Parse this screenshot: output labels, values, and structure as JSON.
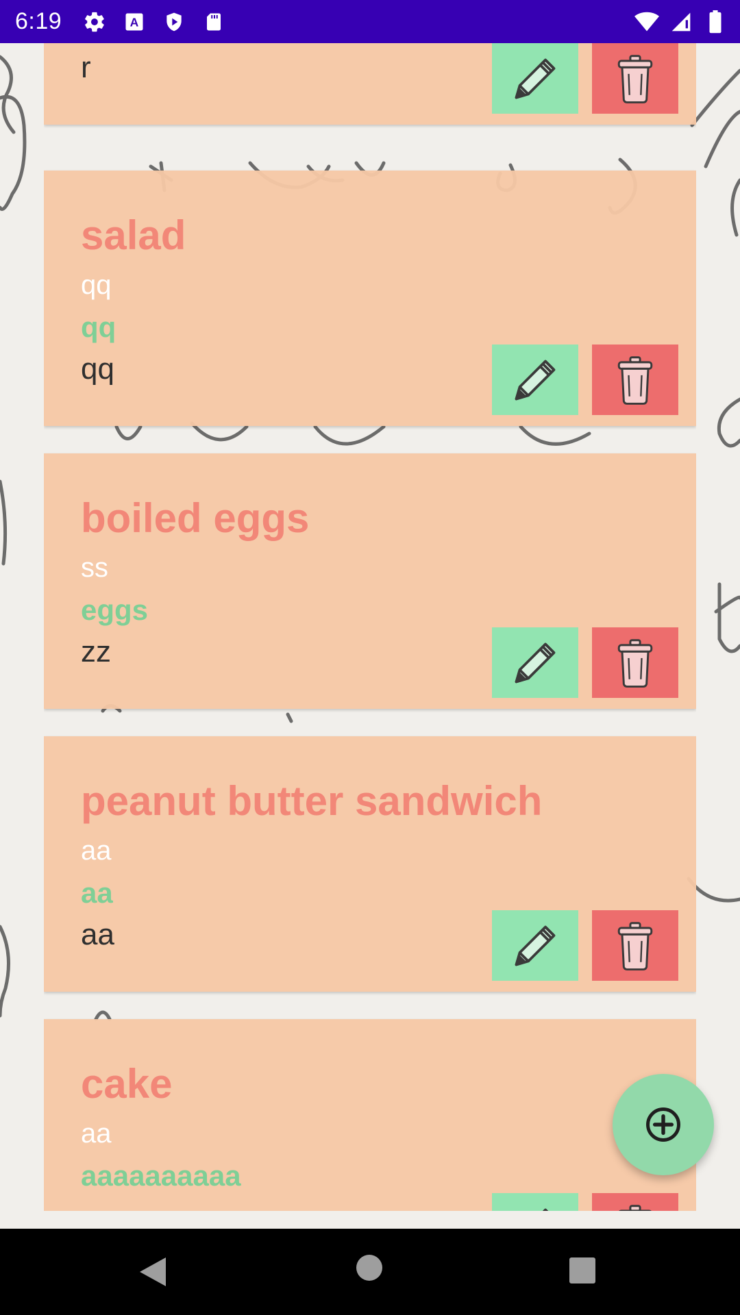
{
  "status_bar": {
    "time": "6:19",
    "left_icons": [
      "settings-icon",
      "a-keyboard-icon",
      "play-protect-icon",
      "sd-card-icon"
    ],
    "right_icons": [
      "wifi-icon",
      "signal-icon",
      "battery-icon"
    ],
    "background": "#3700b3"
  },
  "colors": {
    "card_bg": "#f6c8a6",
    "title": "#f28778",
    "line1": "#ffffff",
    "line2": "#7fcf96",
    "line3": "#2f2f2f",
    "edit_button": "#92e4b1",
    "delete_button": "#ed6d6d",
    "fab": "#92d9aa"
  },
  "cards": [
    {
      "title": "",
      "line1": "",
      "line2": "",
      "line3": "r"
    },
    {
      "title": "salad",
      "line1": "qq",
      "line2": "qq",
      "line3": "qq"
    },
    {
      "title": "boiled eggs",
      "line1": "ss",
      "line2": "eggs",
      "line3": "zz"
    },
    {
      "title": "peanut butter sandwich",
      "line1": "aa",
      "line2": "aa",
      "line3": "aa"
    },
    {
      "title": "cake",
      "line1": "aa",
      "line2": "aaaaaaaaaa",
      "line3": ""
    }
  ],
  "buttons": {
    "edit_icon": "pencil-icon",
    "delete_icon": "trash-icon"
  },
  "fab": {
    "icon": "plus-circle-icon"
  },
  "nav_bar": {
    "icons": [
      "back-icon",
      "home-icon",
      "recents-icon"
    ]
  }
}
